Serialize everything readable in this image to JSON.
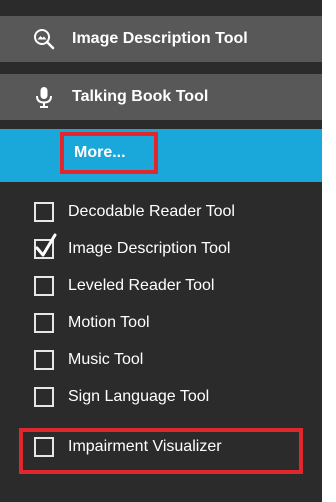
{
  "tool_headers": [
    {
      "label": "Image Description Tool",
      "icon": "magnifier-image-icon"
    },
    {
      "label": "Talking Book Tool",
      "icon": "microphone-icon"
    }
  ],
  "more": {
    "label": "More..."
  },
  "tools_list": [
    {
      "label": "Decodable Reader Tool",
      "checked": false
    },
    {
      "label": "Image Description Tool",
      "checked": true
    },
    {
      "label": "Leveled Reader Tool",
      "checked": false
    },
    {
      "label": "Motion Tool",
      "checked": false
    },
    {
      "label": "Music Tool",
      "checked": false
    },
    {
      "label": "Sign Language Tool",
      "checked": false
    },
    {
      "label": "Impairment Visualizer",
      "checked": false
    }
  ],
  "colors": {
    "panel_bg": "#2b2b2b",
    "header_bg": "#585858",
    "more_bar_bg": "#1aa7d9",
    "highlight": "#e0272e",
    "text": "#ffffff"
  }
}
